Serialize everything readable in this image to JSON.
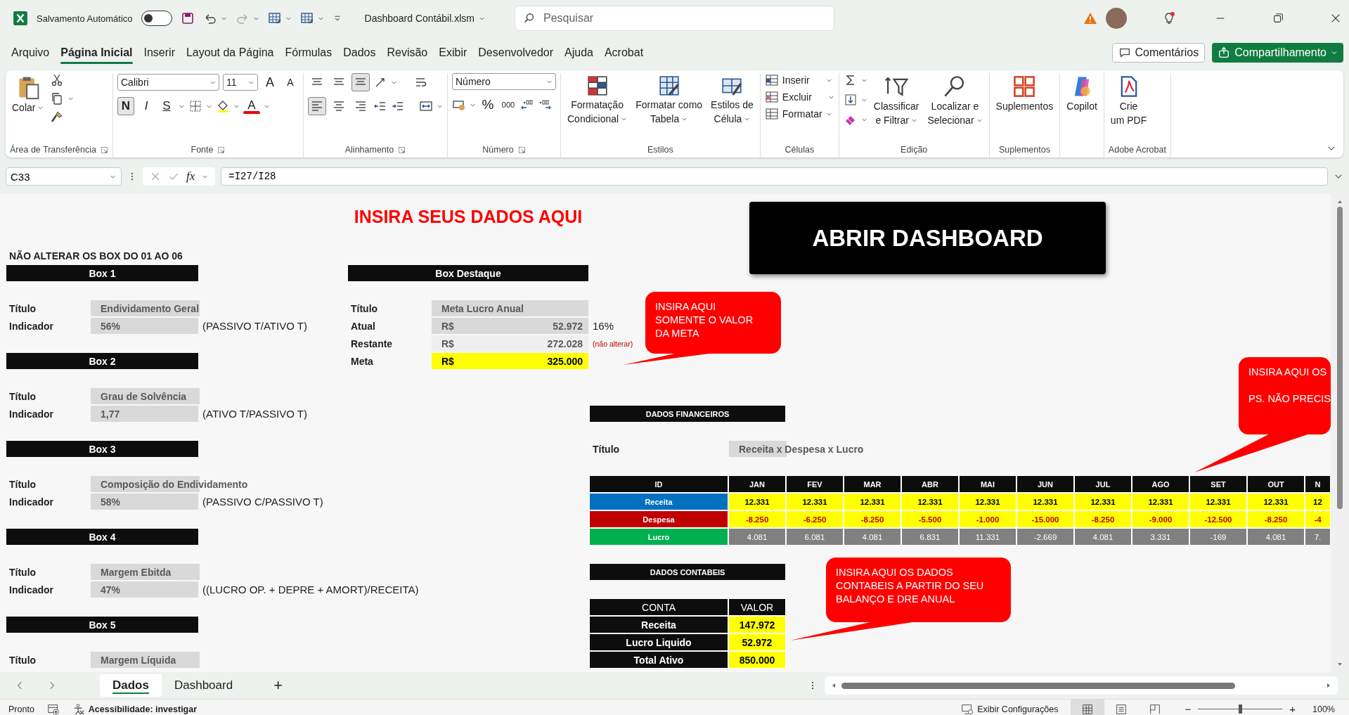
{
  "title_bar": {
    "autosave": {
      "label": "Salvamento Automático",
      "on": false
    },
    "filename": "Dashboard Contábil.xlsm",
    "search": {
      "placeholder": "Pesquisar"
    }
  },
  "menu": {
    "tabs": [
      {
        "label": "Arquivo",
        "selected": false
      },
      {
        "label": "Página Inicial",
        "selected": true
      },
      {
        "label": "Inserir",
        "selected": false
      },
      {
        "label": "Layout da Página",
        "selected": false
      },
      {
        "label": "Fórmulas",
        "selected": false
      },
      {
        "label": "Dados",
        "selected": false
      },
      {
        "label": "Revisão",
        "selected": false
      },
      {
        "label": "Exibir",
        "selected": false
      },
      {
        "label": "Desenvolvedor",
        "selected": false
      },
      {
        "label": "Ajuda",
        "selected": false
      },
      {
        "label": "Acrobat",
        "selected": false
      }
    ],
    "comments": "Comentários",
    "share": "Compartilhamento"
  },
  "ribbon": {
    "groups": [
      {
        "kind": "clipboard",
        "label": "Área de Transferência",
        "launcher": true,
        "items": [
          {
            "lines": [
              "Colar"
            ],
            "dropdown": true
          }
        ]
      },
      {
        "kind": "font",
        "label": "Fonte",
        "launcher": true,
        "font": "Calibri",
        "size": "11",
        "size_buttons": [
          "A",
          "A"
        ],
        "style_buttons": [
          {
            "glyph": "N",
            "selected": true
          },
          {
            "glyph": "I",
            "selected": false
          },
          {
            "glyph": "S",
            "selected": false
          }
        ],
        "color_glyph": "A"
      },
      {
        "kind": "alignment",
        "label": "Alinhamento",
        "launcher": true,
        "vertical": [
          {
            "selected": false
          },
          {
            "selected": false
          },
          {
            "selected": true
          }
        ],
        "horizontal": [
          {
            "selected": true
          },
          {
            "selected": false
          },
          {
            "selected": false
          }
        ]
      },
      {
        "kind": "number",
        "label": "Número",
        "launcher": true,
        "format": "Número",
        "percent": "%",
        "thousands": "000"
      },
      {
        "kind": "styles",
        "label": "Estilos",
        "items": [
          {
            "lines": [
              "Formatação",
              "Condicional"
            ],
            "dropdown": true
          },
          {
            "lines": [
              "Formatar como",
              "Tabela"
            ],
            "dropdown": true
          },
          {
            "lines": [
              "Estilos de",
              "Célula"
            ],
            "dropdown": true
          }
        ]
      },
      {
        "kind": "cells",
        "label": "Células",
        "items": [
          {
            "lines": [
              "Inserir"
            ],
            "dropdown": true
          },
          {
            "lines": [
              "Excluir"
            ],
            "dropdown": true
          },
          {
            "lines": [
              "Formatar"
            ],
            "dropdown": true
          }
        ]
      },
      {
        "kind": "editing",
        "label": "Edição",
        "items": [
          {
            "lines": [
              "Classificar",
              "e Filtrar"
            ],
            "dropdown": true
          },
          {
            "lines": [
              "Localizar e",
              "Selecionar"
            ],
            "dropdown": true
          }
        ]
      },
      {
        "kind": "addins",
        "label": "Suplementos",
        "items": [
          {
            "lines": [
              "Suplementos"
            ]
          }
        ]
      },
      {
        "kind": "copilot",
        "items": [
          {
            "lines": [
              "Copilot"
            ]
          }
        ]
      },
      {
        "kind": "acrobat",
        "label": "Adobe Acrobat",
        "items": [
          {
            "lines": [
              "Crie",
              "um PDF"
            ]
          }
        ]
      }
    ]
  },
  "formula_bar": {
    "name_box": "C33",
    "fx": "fx",
    "formula": "=I27/I28"
  },
  "sheet": {
    "heading": "INSIRA SEUS DADOS AQUI",
    "notice": "NÃO ALTERAR OS BOX DO 01 AO 06",
    "boxes": [
      {
        "header": "Box 1",
        "rows": [
          {
            "label": "Título",
            "value": "Endividamento Geral"
          },
          {
            "label": "Indicador",
            "value": "56%",
            "note": "(PASSIVO T/ATIVO T)"
          }
        ]
      },
      {
        "header": "Box 2",
        "rows": [
          {
            "label": "Título",
            "value": "Grau de Solvência"
          },
          {
            "label": "Indicador",
            "value": "1,77",
            "note": "(ATIVO T/PASSIVO T)"
          }
        ]
      },
      {
        "header": "Box 3",
        "rows": [
          {
            "label": "Título",
            "value": "Composição do Endividamento"
          },
          {
            "label": "Indicador",
            "value": "58%",
            "note": "(PASSIVO C/PASSIVO T)"
          }
        ]
      },
      {
        "header": "Box 4",
        "rows": [
          {
            "label": "Título",
            "value": "Margem Ebitda"
          },
          {
            "label": "Indicador",
            "value": "47%",
            "note": "((LUCRO OP. + DEPRE + AMORT)/RECEITA)"
          }
        ]
      },
      {
        "header": "Box 5",
        "rows": [
          {
            "label": "Título",
            "value": "Margem Líquida"
          }
        ]
      }
    ],
    "highlight_box": {
      "header": "Box Destaque",
      "title_label": "Título",
      "title_value": "Meta Lucro Anual",
      "rows": [
        {
          "label": "Atual",
          "currency": "R$",
          "value": "52.972",
          "kind": "computed",
          "note": "16%"
        },
        {
          "label": "Restante",
          "currency": "R$",
          "value": "272.028",
          "kind": "locked",
          "note": "(não alterar)"
        },
        {
          "label": "Meta",
          "currency": "R$",
          "value": "325.000",
          "kind": "input"
        }
      ]
    },
    "dashboard_button": "ABRIR DASHBOARD",
    "callouts": [
      {
        "paragraphs": [
          [
            "INSIRA AQUI",
            "SOMENTE O VALOR",
            "DA META"
          ]
        ]
      },
      {
        "paragraphs": [
          [
            "INSIRA AQUI OS"
          ],
          [
            "PS. NÃO PRECIS"
          ]
        ]
      },
      {
        "paragraphs": [
          [
            "INSIRA AQUI OS DADOS",
            "CONTABEIS A PARTIR DO SEU",
            "BALANÇO E DRE ANUAL"
          ]
        ]
      }
    ],
    "financial": {
      "header": "DADOS FINANCEIROS",
      "title_label": "Título",
      "title_value": "Receita x Despesa x Lucro",
      "columns": [
        "ID",
        "JAN",
        "FEV",
        "MAR",
        "ABR",
        "MAI",
        "JUN",
        "JUL",
        "AGO",
        "SET",
        "OUT",
        "N"
      ],
      "rows": [
        {
          "label": "Receita",
          "color": "#0070c0",
          "kind": "income",
          "values": [
            "12.331",
            "12.331",
            "12.331",
            "12.331",
            "12.331",
            "12.331",
            "12.331",
            "12.331",
            "12.331",
            "12.331",
            "12"
          ]
        },
        {
          "label": "Despesa",
          "color": "#c00000",
          "kind": "expense",
          "values": [
            "-8.250",
            "-6.250",
            "-8.250",
            "-5.500",
            "-1.000",
            "-15.000",
            "-8.250",
            "-9.000",
            "-12.500",
            "-8.250",
            "-4"
          ]
        },
        {
          "label": "Lucro",
          "color": "#00b050",
          "kind": "result",
          "values": [
            "4.081",
            "6.081",
            "4.081",
            "6.831",
            "11.331",
            "-2.669",
            "4.081",
            "3.331",
            "-169",
            "4.081",
            "7."
          ]
        }
      ]
    },
    "accounting": {
      "header": "DADOS CONTABEIS",
      "columns": [
        "CONTA",
        "VALOR"
      ],
      "rows": [
        {
          "label": "Receita",
          "value": "147.972"
        },
        {
          "label": "Lucro Liquido",
          "value": "52.972"
        },
        {
          "label": "Total Ativo",
          "value": "850.000"
        }
      ]
    }
  },
  "sheet_tabs": {
    "tabs": [
      {
        "label": "Dados",
        "selected": true
      },
      {
        "label": "Dashboard",
        "selected": false
      }
    ],
    "add": "+"
  },
  "status_bar": {
    "ready": "Pronto",
    "accessibility": "Acessibilidade: investigar",
    "display_settings": "Exibir Configurações",
    "views": [
      {
        "selected": true
      },
      {
        "selected": false
      },
      {
        "selected": false
      }
    ],
    "zoom_out": "−",
    "zoom_in": "+",
    "zoom": {
      "level": 0.5
    },
    "zoom_label": "100%"
  }
}
